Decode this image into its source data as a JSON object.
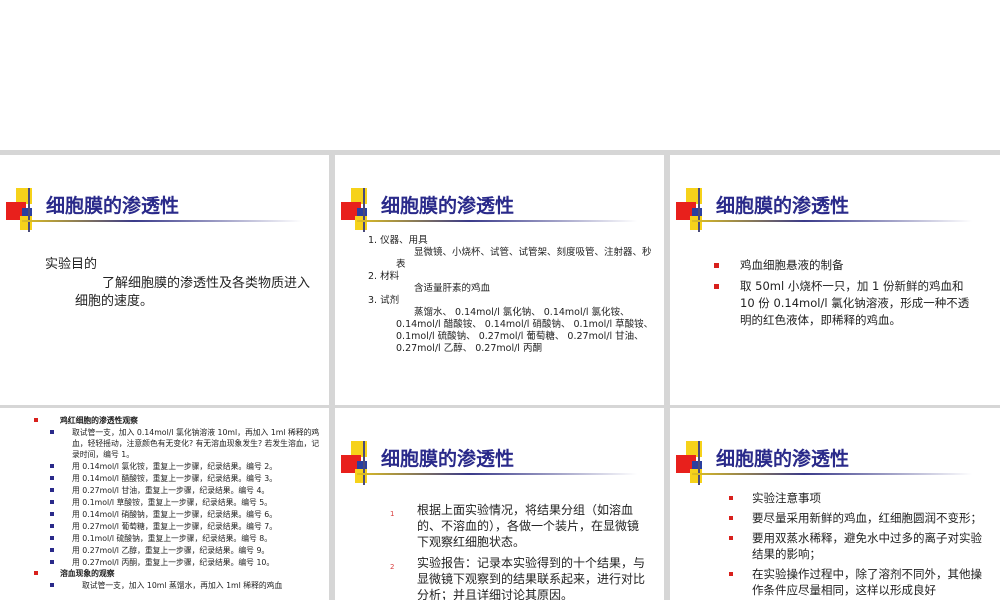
{
  "slides": [
    {
      "title": "细胞膜的渗透性",
      "heading": "实验目的",
      "paragraph": "了解细胞膜的渗透性及各类物质进入细胞的速度。"
    },
    {
      "title": "细胞膜的渗透性",
      "sections": [
        {
          "label": "1. 仪器、用具",
          "text": "显微镜、小烧杯、试管、试管架、刻度吸管、注射器、秒表"
        },
        {
          "label": "2. 材料",
          "text": "含适量肝素的鸡血"
        },
        {
          "label": "3. 试剂",
          "text": "蒸馏水、 0.14mol/l 氯化钠、 0.14mol/l 氯化铵、 0.14mol/l 醋酸铵、 0.14mol/l 硝酸钠、 0.1mol/l 草酸铵、 0.1mol/l 硫酸钠、 0.27mol/l 葡萄糖、 0.27mol/l 甘油、 0.27mol/l 乙醇、 0.27mol/l 丙酮"
        }
      ]
    },
    {
      "title": "细胞膜的渗透性",
      "bullets": [
        "鸡血细胞悬液的制备",
        "取 50ml 小烧杯一只，加 1 份新鲜的鸡血和 10 份 0.14mol/l 氯化钠溶液，形成一种不透明的红色液体，即稀释的鸡血。"
      ]
    },
    {
      "heading1": "鸡红细胞的渗透性观察",
      "steps": [
        "取试管一支，加入 0.14mol/l 氯化钠溶液 10ml，再加入 1ml 稀释的鸡血，轻轻摇动，注意颜色有无变化? 有无溶血现象发生? 若发生溶血，记录时间，编号 1。",
        "用 0.14mol/l 氯化铵，重复上一步骤，纪录结果。编号 2。",
        "用 0.14mol/l 醋酸铵，重复上一步骤，纪录结果。编号 3。",
        "用 0.27mol/l 甘油，重复上一步骤，纪录结果。编号 4。",
        "用 0.1mol/l 草酸铵，重复上一步骤，纪录结果。编号 5。",
        "用 0.14mol/l 硝酸钠，重复上一步骤，纪录结果。编号 6。",
        "用 0.27mol/l 葡萄糖，重复上一步骤，纪录结果。编号 7。",
        "用 0.1mol/l 硫酸钠，重复上一步骤，纪录结果。编号 8。",
        "用 0.27mol/l 乙醇，重复上一步骤，纪录结果。编号 9。",
        "用 0.27mol/l 丙酮，重复上一步骤，纪录结果。编号 10。"
      ],
      "heading2": "溶血现象的观察",
      "tail": "取试管一支，加入 10ml 蒸馏水，再加入 1ml 稀释的鸡血"
    },
    {
      "title": "细胞膜的渗透性",
      "items": [
        {
          "num": "1",
          "text": "根据上面实验情况，将结果分组（如溶血的、不溶血的），各做一个装片，在显微镜下观察红细胞状态。"
        },
        {
          "num": "2",
          "text": "实验报告：记录本实验得到的十个结果，与显微镜下观察到的结果联系起来，进行对比分析；并且详细讨论其原因。"
        }
      ]
    },
    {
      "title": "细胞膜的渗透性",
      "bullets": [
        "实验注意事项",
        "要尽量采用新鲜的鸡血，红细胞圆润不变形；",
        "要用双蒸水稀释，避免水中过多的离子对实验结果的影响；",
        "在实验操作过程中，除了溶剂不同外，其他操作条件应尽量相同，这样以形成良好"
      ]
    }
  ]
}
